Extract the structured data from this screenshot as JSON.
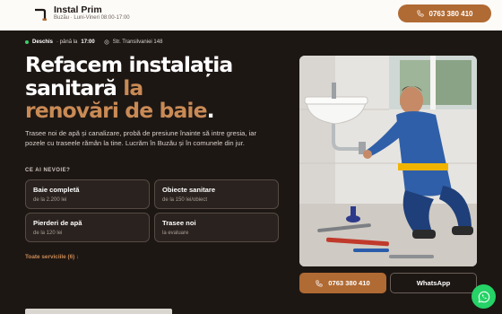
{
  "header": {
    "brand_name": "Instal Prim",
    "brand_sub": "Buzău · Luni-Vineri 08:00-17:00",
    "phone": "0763 380 410"
  },
  "status": {
    "open": "Deschis",
    "until": "· până la",
    "time": "17:00",
    "address": "Str. Transilvaniei 148"
  },
  "hero": {
    "title_line1": "Refacem instalația",
    "title_line2a": "sanitară",
    "title_line2b": "la",
    "title_line3": "renovări de baie",
    "title_dot": ".",
    "description": "Trasee noi de apă și canalizare, probă de presiune înainte să intre gresia, iar pozele cu traseele rămân la tine. Lucrăm în Buzău și în comunele din jur."
  },
  "needs_label": "CE AI NEVOIE?",
  "services": [
    {
      "title": "Baie completă",
      "price": "de la 2.200 lei"
    },
    {
      "title": "Obiecte sanitare",
      "price": "de la 150 lei/obiect"
    },
    {
      "title": "Pierderi de apă",
      "price": "de la 120 lei"
    },
    {
      "title": "Trasee noi",
      "price": "la evaluare"
    }
  ],
  "all_services": "Toate serviciile (6) ↓",
  "cta": {
    "call": "0763 380 410",
    "whatsapp": "WhatsApp"
  },
  "colors": {
    "accent": "#b06a33",
    "accent_text": "#c98a55",
    "background": "#1d1714",
    "whatsapp": "#25d366"
  }
}
